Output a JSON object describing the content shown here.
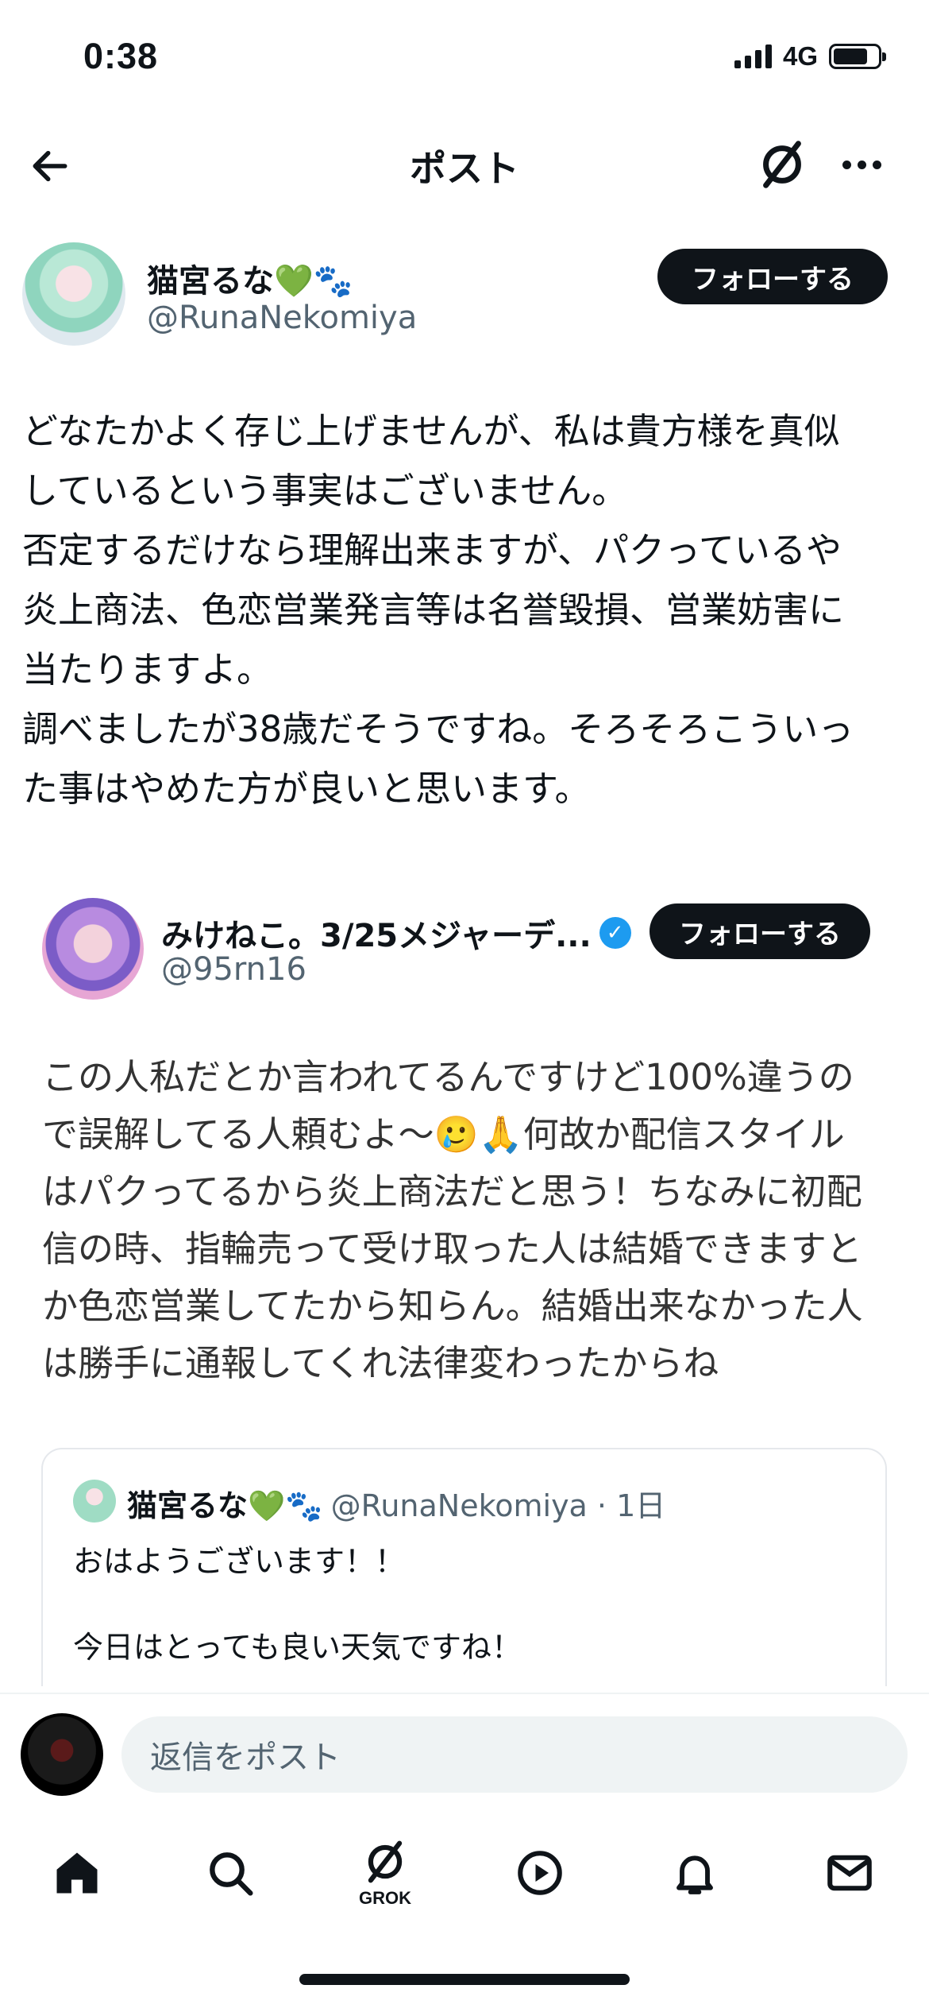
{
  "status": {
    "time": "0:38",
    "network": "4G"
  },
  "header": {
    "title": "ポスト"
  },
  "author": {
    "name": "猫宮るな💚🐾",
    "handle": "@RunaNekomiya",
    "follow_label": "フォローする"
  },
  "post": {
    "text": "どなたかよく存じ上げませんが、私は貴方様を真似\nしているという事実はございません。\n否定するだけなら理解出来ますが、パクっているや\n炎上商法、色恋営業発言等は名誉毀損、営業妨害に\n当たりますよ。\n調べましたが38歳だそうですね。そろそろこういっ\nた事はやめた方が良いと思います。"
  },
  "quoted": {
    "name": "みけねこ。3/25メジャーデ...",
    "handle": "@95rn16",
    "follow_label": "フォローする",
    "text": "この人私だとか言われてるんですけど100%違うの\nで誤解してる人頼むよ〜🥲🙏何故か配信スタイル\nはパクってるから炎上商法だと思う！ちなみに初配\n信の時、指輪売って受け取った人は結婚できますと\nか色恋営業してたから知らん。結婚出来なかった人\nは勝手に通報してくれ法律変わったからね"
  },
  "nested": {
    "name": "猫宮るな💚🐾",
    "handle_time": "@RunaNekomiya · 1日",
    "line1": "おはようございます！！",
    "line2": "今日はとっても良い天気ですね！"
  },
  "reply": {
    "placeholder": "返信をポスト"
  },
  "tabs": {
    "grok_label": "GROK"
  }
}
